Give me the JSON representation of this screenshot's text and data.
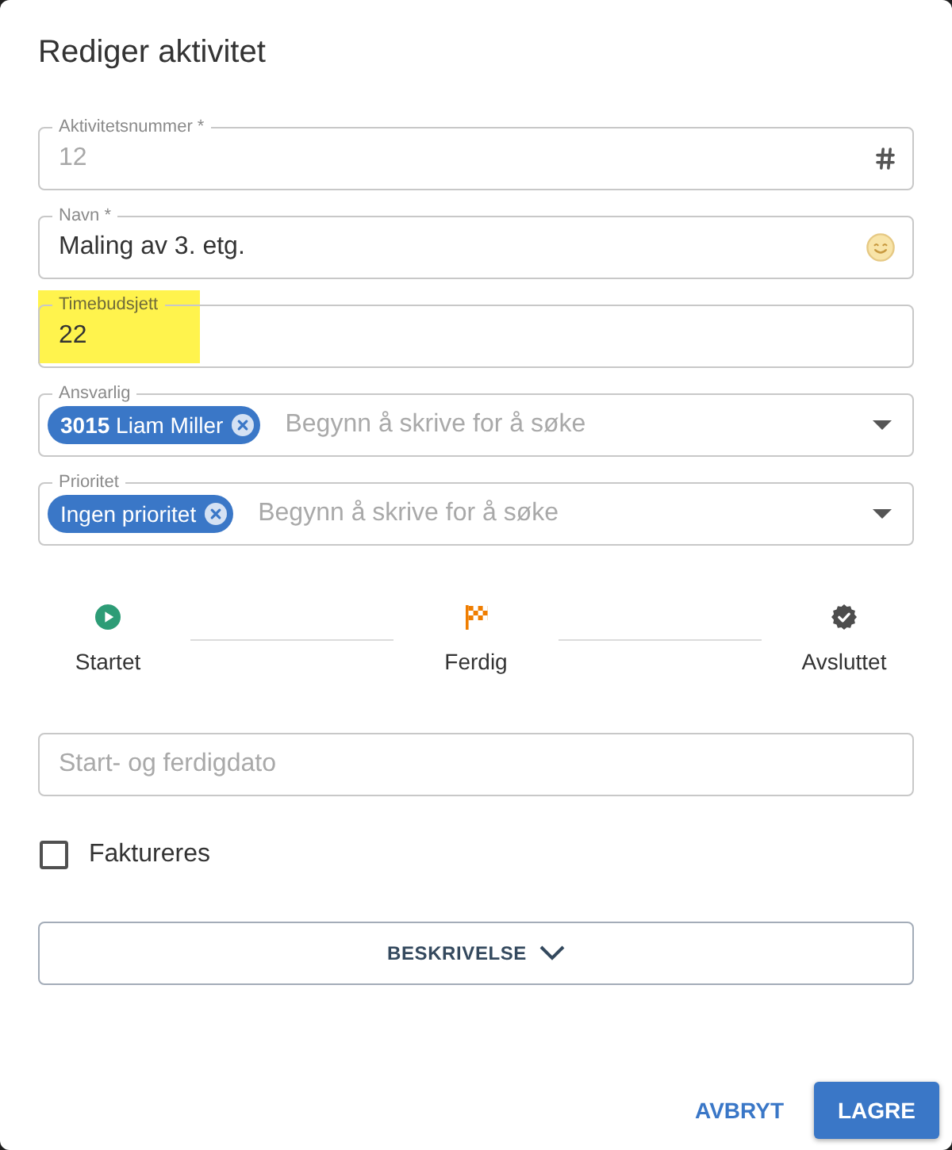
{
  "dialog": {
    "title": "Rediger aktivitet"
  },
  "fields": [
    {
      "kind": "number",
      "label": "Aktivitetsnummer *",
      "value": "12",
      "disabled": true,
      "highlighted": false,
      "emoji_button": false
    },
    {
      "kind": "text",
      "label": "Navn *",
      "value": "Maling av 3. etg.",
      "disabled": false,
      "highlighted": false,
      "emoji_button": true
    },
    {
      "kind": "text",
      "label": "Timebudsjett",
      "value": "22",
      "disabled": false,
      "highlighted": true,
      "emoji_button": false
    },
    {
      "kind": "select",
      "label": "Ansvarlig",
      "chips": [
        "**3015** Liam Miller"
      ],
      "placeholder": "Begynn å skrive for å søke",
      "highlighted": false
    },
    {
      "kind": "select",
      "label": "Prioritet",
      "chips": [
        "Ingen prioritet"
      ],
      "placeholder": "Begynn å skrive for å søke",
      "highlighted": false
    }
  ],
  "steps": [
    {
      "kind": "start",
      "label": "Startet",
      "color": "#2d9c76"
    },
    {
      "kind": "finish",
      "label": "Ferdig",
      "color": "#ef7d00"
    },
    {
      "kind": "close",
      "label": "Avsluttet",
      "color": "#4d4d4d"
    }
  ],
  "date_range": {
    "placeholder": "Start- og ferdigdato"
  },
  "checkbox": {
    "label": "Faktureres",
    "checked": false
  },
  "description": {
    "label": "BESKRIVELSE",
    "expanded": false
  },
  "actions": [
    {
      "kind": "cancel",
      "label": "AVBRYT"
    },
    {
      "kind": "save",
      "label": "LAGRE"
    }
  ]
}
